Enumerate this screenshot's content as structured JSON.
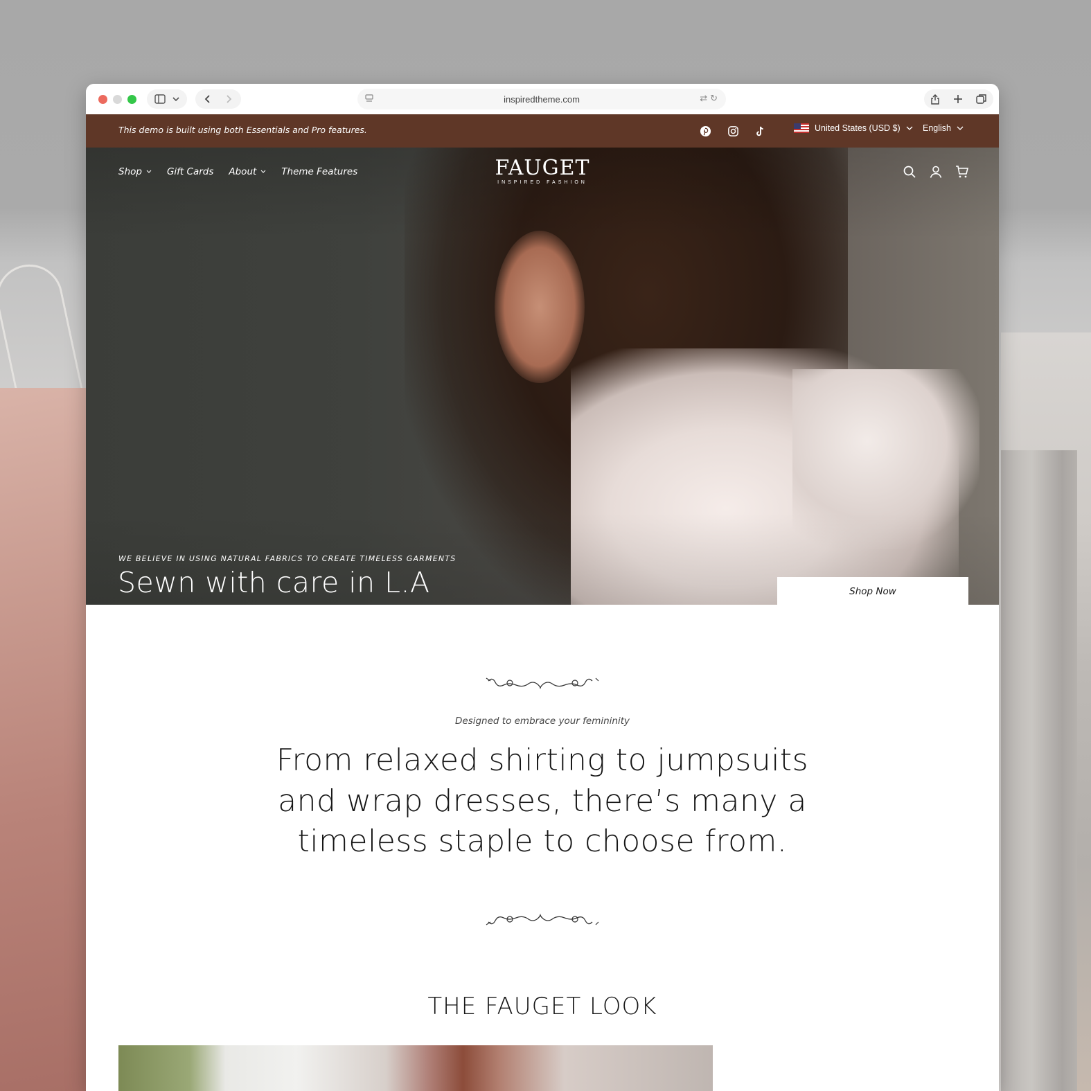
{
  "browser": {
    "url": "inspiredtheme.com"
  },
  "announcement": {
    "text": "This demo is built using both Essentials and Pro features.",
    "social": [
      "pinterest-icon",
      "instagram-icon",
      "tiktok-icon"
    ],
    "country": "United States (USD $)",
    "language": "English"
  },
  "header": {
    "nav": {
      "shop": "Shop",
      "gift_cards": "Gift Cards",
      "about": "About",
      "theme_features": "Theme Features"
    },
    "logo": {
      "main": "FAUGET",
      "sub": "INSPIRED FASHION"
    },
    "icons": [
      "search-icon",
      "account-icon",
      "cart-icon"
    ]
  },
  "hero": {
    "eyebrow": "WE BELIEVE IN USING NATURAL FABRICS TO CREATE TIMELESS GARMENTS",
    "heading": "Sewn with care in L.A",
    "button": "Shop Now"
  },
  "intro": {
    "tagline": "Designed to embrace your femininity",
    "text": "From relaxed shirting to jumpsuits and wrap dresses, there’s many a timeless staple to choose from."
  },
  "collection": {
    "title": "THE FAUGET LOOK"
  },
  "colors": {
    "announcement_bg": "#5f3727",
    "text_dark": "#161616",
    "button_bg": "#ffffff"
  }
}
